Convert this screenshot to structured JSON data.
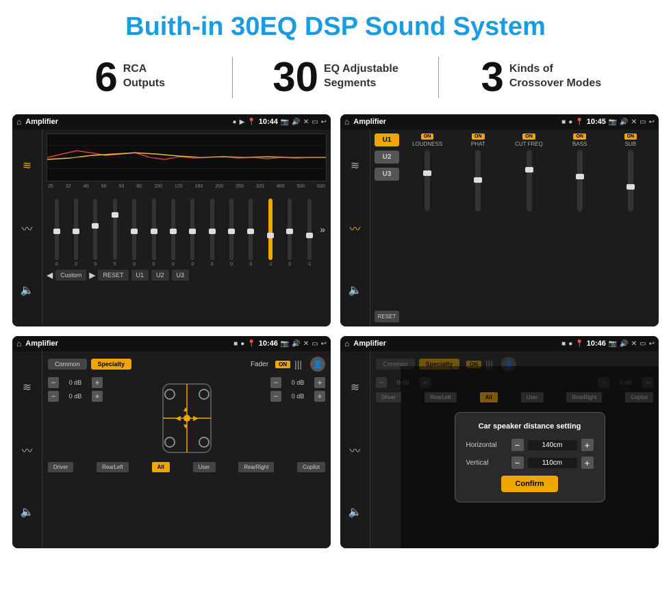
{
  "page": {
    "title": "Buith-in 30EQ DSP Sound System"
  },
  "stats": [
    {
      "number": "6",
      "text": "RCA\nOutputs"
    },
    {
      "number": "30",
      "text": "EQ Adjustable\nSegments"
    },
    {
      "number": "3",
      "text": "Kinds of\nCrossover Modes"
    }
  ],
  "screen1": {
    "status": {
      "title": "Amplifier",
      "time": "10:44"
    },
    "eq_freqs": [
      "25",
      "32",
      "40",
      "50",
      "63",
      "80",
      "100",
      "125",
      "160",
      "200",
      "250",
      "320",
      "400",
      "500",
      "630"
    ],
    "eq_values": [
      "0",
      "0",
      "0",
      "5",
      "0",
      "0",
      "0",
      "0",
      "0",
      "0",
      "0",
      "-1",
      "0",
      "-1"
    ],
    "buttons": [
      "Custom",
      "RESET",
      "U1",
      "U2",
      "U3"
    ]
  },
  "screen2": {
    "status": {
      "title": "Amplifier",
      "time": "10:45"
    },
    "channels": [
      "LOUDNESS",
      "PHAT",
      "CUT FREQ",
      "BASS",
      "SUB"
    ],
    "u_buttons": [
      "U1",
      "U2",
      "U3"
    ],
    "reset_label": "RESET"
  },
  "screen3": {
    "status": {
      "title": "Amplifier",
      "time": "10:46"
    },
    "tabs": [
      "Common",
      "Specialty"
    ],
    "fader_label": "Fader",
    "fader_on": "ON",
    "db_values": [
      "0 dB",
      "0 dB",
      "0 dB",
      "0 dB"
    ],
    "bottom_buttons": [
      "Driver",
      "RearLeft",
      "All",
      "User",
      "RearRight",
      "Copilot"
    ]
  },
  "screen4": {
    "status": {
      "title": "Amplifier",
      "time": "10:46"
    },
    "tabs": [
      "Common",
      "Specialty"
    ],
    "dialog": {
      "title": "Car speaker distance setting",
      "horizontal_label": "Horizontal",
      "horizontal_value": "140cm",
      "vertical_label": "Vertical",
      "vertical_value": "110cm",
      "confirm_label": "Confirm"
    },
    "db_values": [
      "0 dB",
      "0 dB"
    ],
    "bottom_buttons": [
      "Driver",
      "RearLeft",
      "All",
      "User",
      "RearRight",
      "Copilot"
    ]
  }
}
